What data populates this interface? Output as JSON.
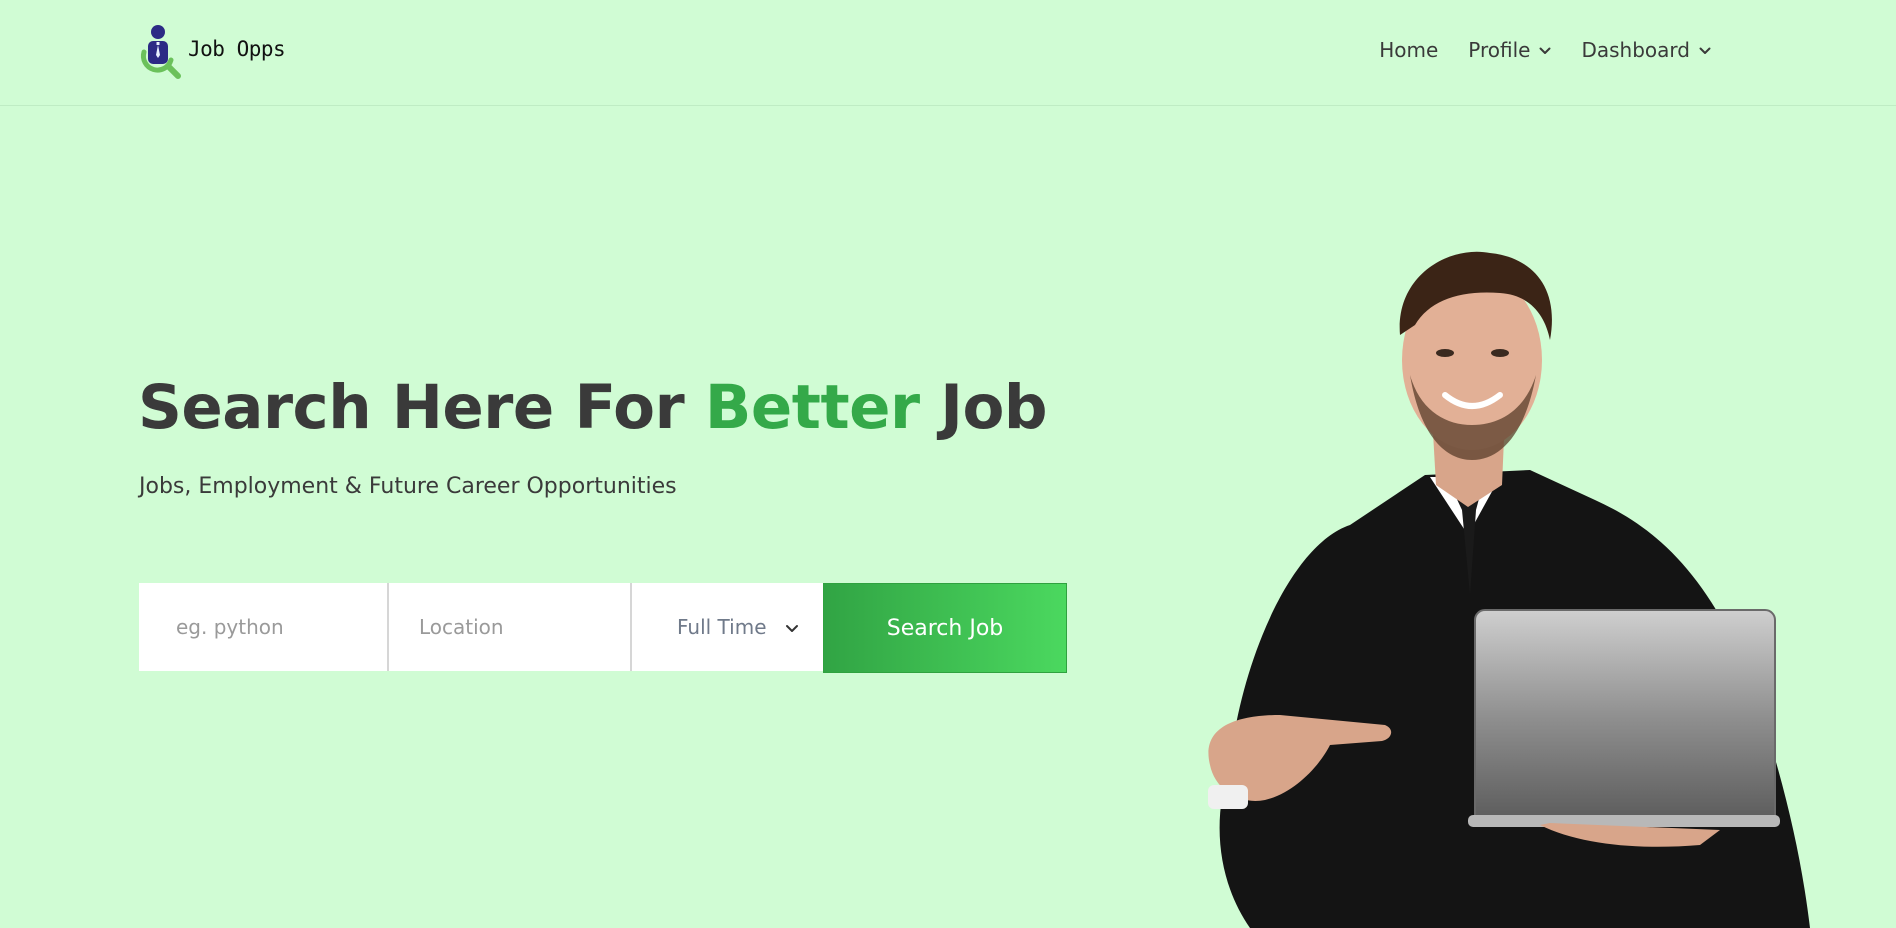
{
  "brand": {
    "name": "Job Opps",
    "logo_icon": "job-seeker-magnifier-icon"
  },
  "nav": {
    "items": [
      {
        "label": "Home",
        "has_dropdown": false
      },
      {
        "label": "Profile",
        "has_dropdown": true
      },
      {
        "label": "Dashboard",
        "has_dropdown": true
      }
    ]
  },
  "hero": {
    "title_before": "Search Here For ",
    "title_accent": "Better",
    "title_after": " Job",
    "subtitle": "Jobs, Employment & Future Career Opportunities"
  },
  "search": {
    "keyword_placeholder": "eg. python",
    "location_placeholder": "Location",
    "job_type_selected": "Full Time",
    "button_label": "Search Job"
  },
  "colors": {
    "background": "#d0fcd4",
    "accent": "#34a949",
    "button_start": "#31a444",
    "button_end": "#4bd85f",
    "text": "#3a3a3a"
  }
}
